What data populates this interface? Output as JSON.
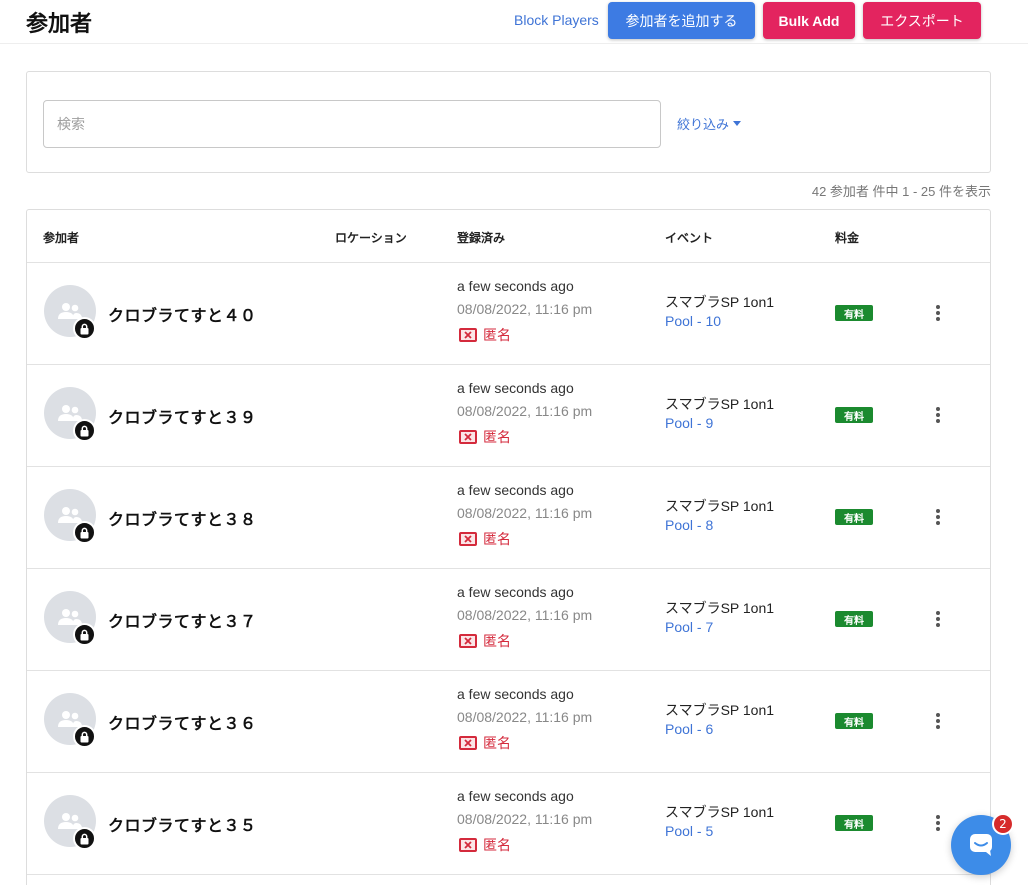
{
  "header": {
    "title": "参加者",
    "block_players": "Block Players",
    "add_participant": "参加者を追加する",
    "bulk_add": "Bulk Add",
    "export": "エクスポート"
  },
  "search": {
    "placeholder": "検索",
    "filter": "絞り込み"
  },
  "count_text": "42 参加者 件中 1 - 25 件を表示",
  "table": {
    "columns": [
      "参加者",
      "ロケーション",
      "登録済み",
      "イベント",
      "料金"
    ],
    "rows": [
      {
        "name": "クロブラてすと４０",
        "registered_rel": "a few seconds ago",
        "registered_date": "08/08/2022, 11:16 pm",
        "anon": "匿名",
        "event": "スマブラSP 1on1",
        "pool": "Pool - 10",
        "fee": "有料"
      },
      {
        "name": "クロブラてすと３９",
        "registered_rel": "a few seconds ago",
        "registered_date": "08/08/2022, 11:16 pm",
        "anon": "匿名",
        "event": "スマブラSP 1on1",
        "pool": "Pool - 9",
        "fee": "有料"
      },
      {
        "name": "クロブラてすと３８",
        "registered_rel": "a few seconds ago",
        "registered_date": "08/08/2022, 11:16 pm",
        "anon": "匿名",
        "event": "スマブラSP 1on1",
        "pool": "Pool - 8",
        "fee": "有料"
      },
      {
        "name": "クロブラてすと３７",
        "registered_rel": "a few seconds ago",
        "registered_date": "08/08/2022, 11:16 pm",
        "anon": "匿名",
        "event": "スマブラSP 1on1",
        "pool": "Pool - 7",
        "fee": "有料"
      },
      {
        "name": "クロブラてすと３６",
        "registered_rel": "a few seconds ago",
        "registered_date": "08/08/2022, 11:16 pm",
        "anon": "匿名",
        "event": "スマブラSP 1on1",
        "pool": "Pool - 6",
        "fee": "有料"
      },
      {
        "name": "クロブラてすと３５",
        "registered_rel": "a few seconds ago",
        "registered_date": "08/08/2022, 11:16 pm",
        "anon": "匿名",
        "event": "スマブラSP 1on1",
        "pool": "Pool - 5",
        "fee": "有料"
      }
    ]
  },
  "chat": {
    "unread": "2",
    "icon": "chat-bubble-icon"
  },
  "colors": {
    "primary": "#3d7be3",
    "accent": "#e3245f",
    "paid": "#1b8a2f",
    "anon": "#d42a3c"
  }
}
